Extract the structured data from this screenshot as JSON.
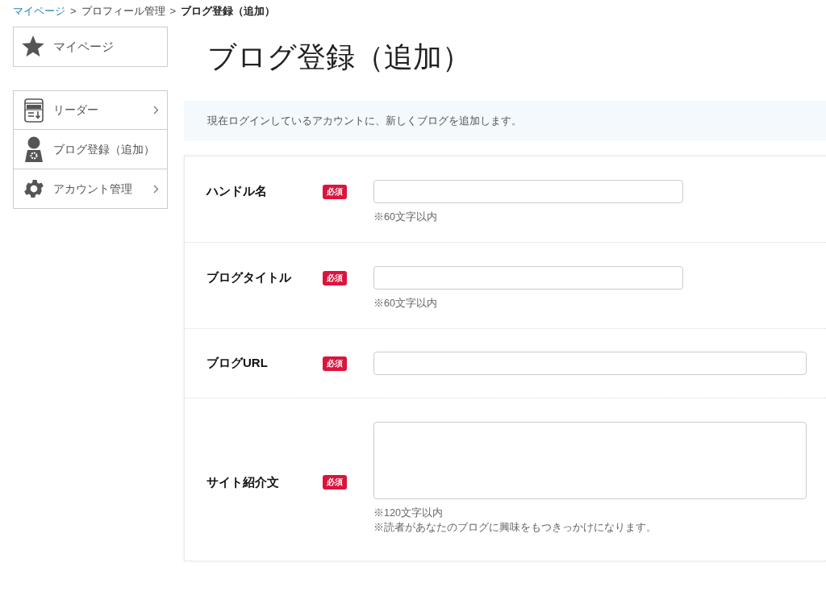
{
  "breadcrumb": [
    {
      "label": "マイページ",
      "kind": "link"
    },
    {
      "label": "プロフィール管理",
      "kind": "plain"
    },
    {
      "label": "ブログ登録（追加）",
      "kind": "current"
    }
  ],
  "breadcrumb_separator": ">",
  "sidebar": {
    "top": {
      "label": "マイページ"
    },
    "items": [
      {
        "label": "リーダー",
        "has_submenu": true
      },
      {
        "label": "ブログ登録（追加）",
        "has_submenu": false
      },
      {
        "label": "アカウント管理",
        "has_submenu": true
      }
    ]
  },
  "page_title": "ブログ登録（追加）",
  "notice": "現在ログインしているアカウントに、新しくブログを追加します。",
  "form": [
    {
      "label": "ハンドル名",
      "badge": "必須",
      "kind": "short_input",
      "hints": [
        "※60文字以内"
      ]
    },
    {
      "label": "ブログタイトル",
      "badge": "必須",
      "kind": "short_input",
      "hints": [
        "※60文字以内"
      ]
    },
    {
      "label": "ブログURL",
      "badge": "必須",
      "kind": "input"
    },
    {
      "label": "サイト紹介文",
      "badge": "必須",
      "kind": "textarea",
      "hints": [
        "※120文字以内",
        "※読者があなたのブログに興味をもつきっかけになります。"
      ]
    }
  ]
}
